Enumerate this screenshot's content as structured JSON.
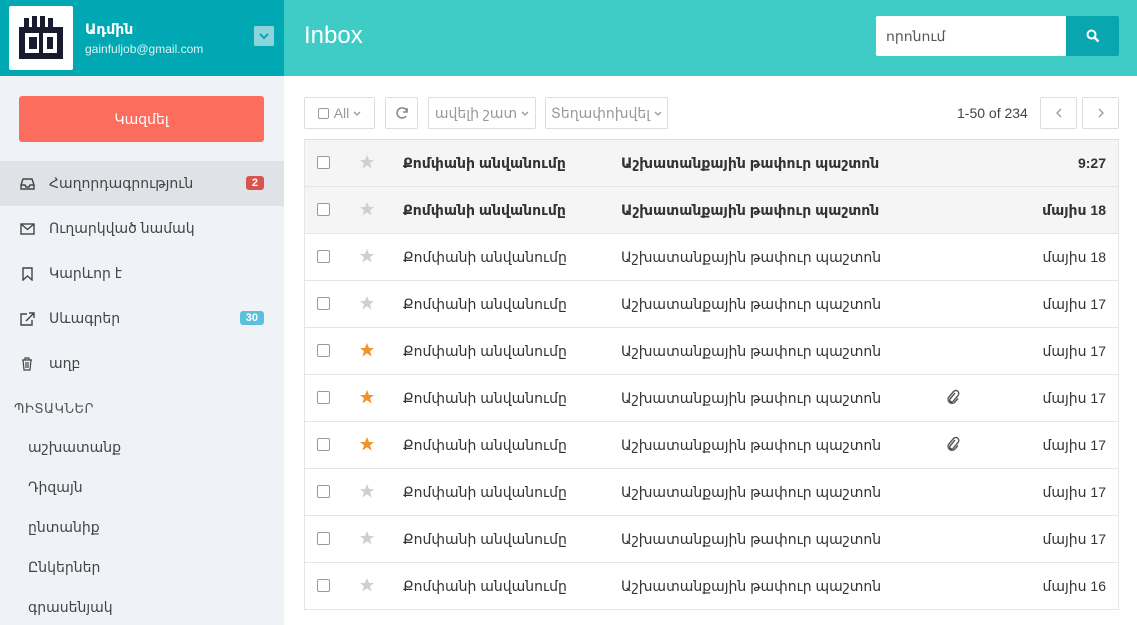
{
  "profile": {
    "name": "Ադմին",
    "email": "gainfuljob@gmail.com"
  },
  "compose_label": "Կազմել",
  "nav": [
    {
      "label": "Հաղորդագրություն",
      "icon": "inbox-icon",
      "badge": "2",
      "badge_color": "#d9534f",
      "active": true
    },
    {
      "label": "Ուղարկված նամակ",
      "icon": "envelope-icon",
      "badge": "",
      "active": false
    },
    {
      "label": "Կարևոր է",
      "icon": "bookmark-icon",
      "badge": "",
      "active": false
    },
    {
      "label": "Սևագրեր",
      "icon": "external-link-icon",
      "badge": "30",
      "badge_color": "#5bc0de",
      "active": false
    },
    {
      "label": "աղբ",
      "icon": "trash-icon",
      "badge": "",
      "active": false
    }
  ],
  "labels_title": "ՊԻՏԱԿՆԵՐ",
  "labels": [
    "աշխատանք",
    "Դիզայն",
    "ընտանիք",
    "Ընկերներ",
    "գրասենյակ"
  ],
  "header": {
    "title": "Inbox"
  },
  "search": {
    "placeholder": "որոնում"
  },
  "toolbar": {
    "select_all": "All",
    "more": "ավելի շատ",
    "move": "Տեղափոխվել"
  },
  "pagination": {
    "text": "1-50 of 234"
  },
  "colors": {
    "header": "#40ccc6",
    "profile": "#00a8b3",
    "compose": "#fc6d5e",
    "star_active": "#f0932b",
    "star_inactive": "#cfcfcf"
  },
  "emails": [
    {
      "sender": "Քոմփանի անվանումը",
      "subject": "Աշխատանքային թափուր պաշտոն",
      "date": "9:27",
      "unread": true,
      "starred": false,
      "attachment": false
    },
    {
      "sender": "Քոմփանի անվանումը",
      "subject": "Աշխատանքային թափուր պաշտոն",
      "date": "մայիս 18",
      "unread": true,
      "starred": false,
      "attachment": false
    },
    {
      "sender": "Քոմփանի անվանումը",
      "subject": "Աշխատանքային թափուր պաշտոն",
      "date": "մայիս 18",
      "unread": false,
      "starred": false,
      "attachment": false
    },
    {
      "sender": "Քոմփանի անվանումը",
      "subject": "Աշխատանքային թափուր պաշտոն",
      "date": "մայիս 17",
      "unread": false,
      "starred": false,
      "attachment": false
    },
    {
      "sender": "Քոմփանի անվանումը",
      "subject": "Աշխատանքային թափուր պաշտոն",
      "date": "մայիս 17",
      "unread": false,
      "starred": true,
      "attachment": false
    },
    {
      "sender": "Քոմփանի անվանումը",
      "subject": "Աշխատանքային թափուր պաշտոն",
      "date": "մայիս 17",
      "unread": false,
      "starred": true,
      "attachment": true
    },
    {
      "sender": "Քոմփանի անվանումը",
      "subject": "Աշխատանքային թափուր պաշտոն",
      "date": "մայիս 17",
      "unread": false,
      "starred": true,
      "attachment": true
    },
    {
      "sender": "Քոմփանի անվանումը",
      "subject": "Աշխատանքային թափուր պաշտոն",
      "date": "մայիս 17",
      "unread": false,
      "starred": false,
      "attachment": false
    },
    {
      "sender": "Քոմփանի անվանումը",
      "subject": "Աշխատանքային թափուր պաշտոն",
      "date": "մայիս 17",
      "unread": false,
      "starred": false,
      "attachment": false
    },
    {
      "sender": "Քոմփանի անվանումը",
      "subject": "Աշխատանքային թափուր պաշտոն",
      "date": "մայիս 16",
      "unread": false,
      "starred": false,
      "attachment": false
    }
  ]
}
